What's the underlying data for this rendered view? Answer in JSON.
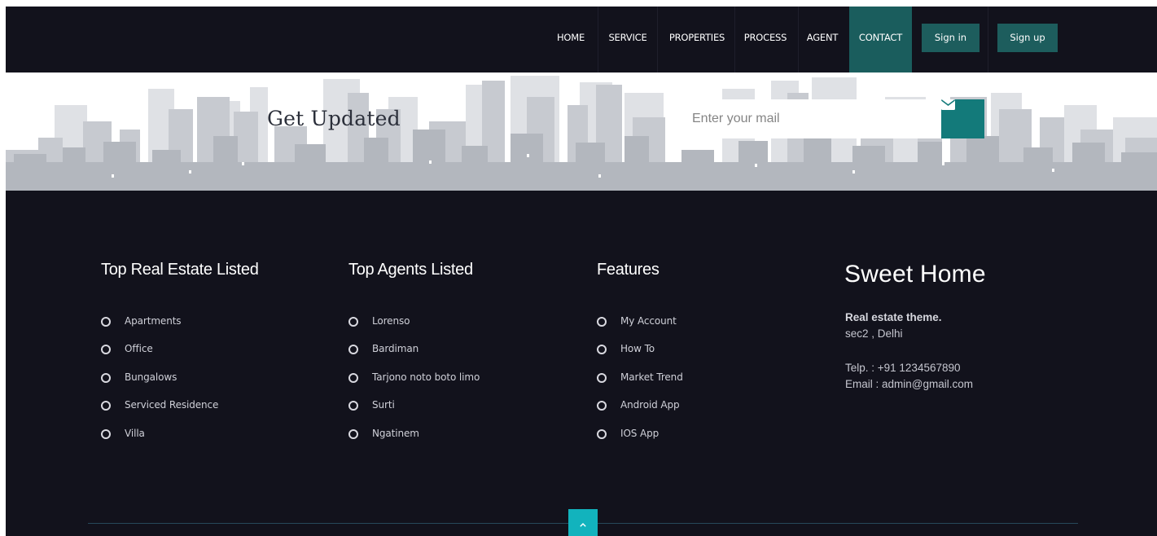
{
  "nav": {
    "items": [
      {
        "label": "HOME",
        "active": false
      },
      {
        "label": "SERVICE",
        "active": false
      },
      {
        "label": "PROPERTIES",
        "active": false
      },
      {
        "label": "PROCESS",
        "active": false
      },
      {
        "label": "AGENT",
        "active": false
      },
      {
        "label": "CONTACT",
        "active": true
      }
    ],
    "signin_label": "Sign in",
    "signup_label": "Sign up"
  },
  "banner": {
    "title": "Get Updated",
    "mail_placeholder": "Enter your mail",
    "mail_value": "",
    "submit_icon": "envelope-icon"
  },
  "footer": {
    "columns": [
      {
        "title": "Top Real Estate Listed",
        "links": [
          "Apartments",
          "Office",
          "Bungalows",
          "Serviced Residence",
          "Villa"
        ]
      },
      {
        "title": "Top Agents Listed",
        "links": [
          "Lorenso",
          "Bardiman",
          "Tarjono noto boto limo",
          "Surti",
          "Ngatinem"
        ]
      },
      {
        "title": "Features",
        "links": [
          "My Account",
          "How To",
          "Market Trend",
          "Android App",
          "IOS App"
        ]
      }
    ],
    "brand": {
      "name": "Sweet Home",
      "tagline": "Real estate theme.",
      "address": "sec2 , Delhi",
      "phone": "Telp. : +91 1234567890",
      "email": "Email : admin@gmail.com"
    },
    "scroll_top_icon": "chevron-up-icon"
  },
  "colors": {
    "background": "#12121c",
    "accent": "#1d5d5d",
    "teal_button": "#137a7a",
    "scroll_top": "#12b3bd"
  }
}
